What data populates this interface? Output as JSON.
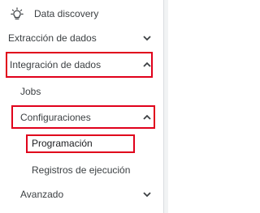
{
  "nav": {
    "top_item": {
      "icon": "lightbulb-icon",
      "label": "Data discovery"
    },
    "sections": [
      {
        "label": "Extracción de dados",
        "state": "collapsed"
      },
      {
        "label": "Integración de dados",
        "state": "expanded",
        "children": [
          {
            "label": "Jobs"
          },
          {
            "label": "Configuraciones",
            "state": "expanded",
            "children": [
              {
                "label": "Programación",
                "selected": true
              },
              {
                "label": "Registros de ejecución"
              }
            ]
          }
        ]
      },
      {
        "label": "Avanzado",
        "state": "collapsed"
      }
    ]
  },
  "colors": {
    "highlight_border": "#e0001b",
    "text": "#3c4043",
    "divider": "#dadce0"
  }
}
